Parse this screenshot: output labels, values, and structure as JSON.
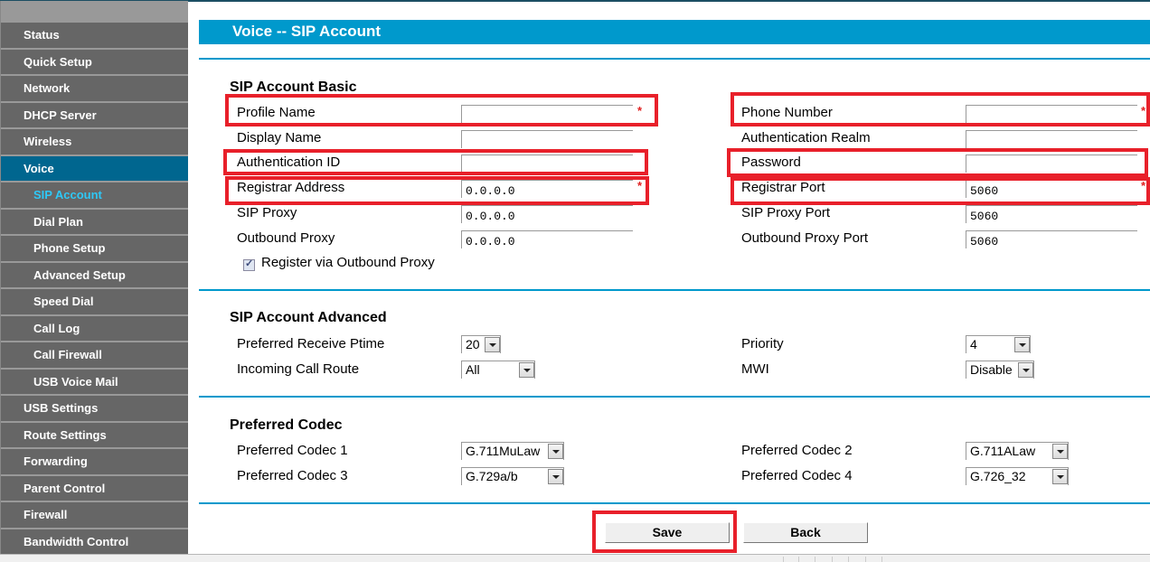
{
  "sidebar": {
    "items": [
      {
        "label": "Status",
        "level": 0
      },
      {
        "label": "Quick Setup",
        "level": 0
      },
      {
        "label": "Network",
        "level": 0
      },
      {
        "label": "DHCP Server",
        "level": 0
      },
      {
        "label": "Wireless",
        "level": 0
      },
      {
        "label": "Voice",
        "level": 0,
        "active": true
      },
      {
        "label": "SIP Account",
        "level": 1,
        "current": true
      },
      {
        "label": "Dial Plan",
        "level": 1
      },
      {
        "label": "Phone Setup",
        "level": 1
      },
      {
        "label": "Advanced Setup",
        "level": 1
      },
      {
        "label": "Speed Dial",
        "level": 1
      },
      {
        "label": "Call Log",
        "level": 1
      },
      {
        "label": "Call Firewall",
        "level": 1
      },
      {
        "label": "USB Voice Mail",
        "level": 1
      },
      {
        "label": "USB Settings",
        "level": 0
      },
      {
        "label": "Route Settings",
        "level": 0
      },
      {
        "label": "Forwarding",
        "level": 0
      },
      {
        "label": "Parent Control",
        "level": 0
      },
      {
        "label": "Firewall",
        "level": 0
      },
      {
        "label": "Bandwidth Control",
        "level": 0
      }
    ]
  },
  "page": {
    "title": "Voice -- SIP Account"
  },
  "basic": {
    "title": "SIP Account Basic",
    "left": [
      {
        "label": "Profile Name",
        "value": "",
        "required": true
      },
      {
        "label": "Display Name",
        "value": ""
      },
      {
        "label": "Authentication ID",
        "value": ""
      },
      {
        "label": "Registrar Address",
        "value": "0.0.0.0",
        "required": true
      },
      {
        "label": "SIP Proxy",
        "value": "0.0.0.0"
      },
      {
        "label": "Outbound Proxy",
        "value": "0.0.0.0"
      }
    ],
    "right": [
      {
        "label": "Phone Number",
        "value": "",
        "required": true
      },
      {
        "label": "Authentication Realm",
        "value": ""
      },
      {
        "label": "Password",
        "value": ""
      },
      {
        "label": "Registrar Port",
        "value": "5060",
        "required": true
      },
      {
        "label": "SIP Proxy Port",
        "value": "5060"
      },
      {
        "label": "Outbound Proxy Port",
        "value": "5060"
      }
    ],
    "register_via_outbound": {
      "label": "Register via Outbound Proxy",
      "checked": true
    },
    "required_mark": "*"
  },
  "advanced": {
    "title": "SIP Account Advanced",
    "ptime": {
      "label": "Preferred Receive Ptime",
      "value": "20"
    },
    "route": {
      "label": "Incoming Call Route",
      "value": "All"
    },
    "priority": {
      "label": "Priority",
      "value": "4"
    },
    "mwi": {
      "label": "MWI",
      "value": "Disable"
    }
  },
  "codec": {
    "title": "Preferred Codec",
    "c1": {
      "label": "Preferred Codec 1",
      "value": "G.711MuLaw"
    },
    "c2": {
      "label": "Preferred Codec 2",
      "value": "G.711ALaw"
    },
    "c3": {
      "label": "Preferred Codec 3",
      "value": "G.729a/b"
    },
    "c4": {
      "label": "Preferred Codec 4",
      "value": "G.726_32"
    }
  },
  "buttons": {
    "save": "Save",
    "back": "Back"
  },
  "colors": {
    "accent": "#0099cc",
    "highlight": "#e8202a",
    "sidebar_active": "#00668f",
    "sidebar_current_text": "#2ec8f7"
  }
}
